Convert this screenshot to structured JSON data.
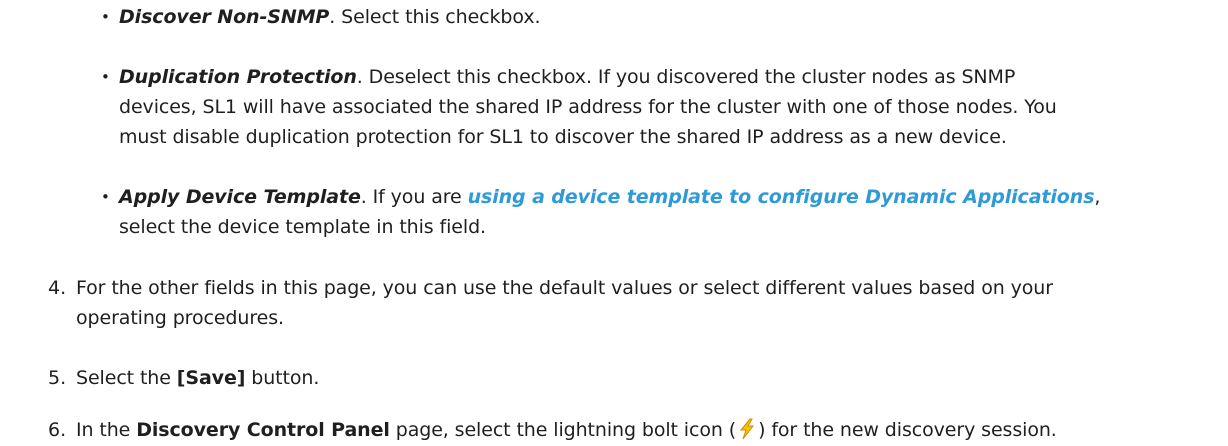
{
  "bullets": [
    {
      "term": "Discover Non-SNMP",
      "lines": [
        ". Select this checkbox."
      ]
    },
    {
      "term": "Duplication Protection",
      "lines": [
        ". Deselect this checkbox. If you discovered the cluster nodes as SNMP",
        "devices, SL1 will have associated the shared IP address for the cluster with one of those nodes. You",
        "must disable duplication protection for SL1 to discover the shared IP address as a new device."
      ]
    },
    {
      "term": "Apply Device Template",
      "pre_link": ". If you are ",
      "link": "using a device template to configure Dynamic Applications",
      "post_link": ",",
      "lines": [
        "select the device template in this field."
      ]
    }
  ],
  "steps": [
    {
      "number": "4.",
      "lines": [
        "For the other fields in this page, you can use the default values or select different values based on your",
        "operating procedures."
      ]
    },
    {
      "number": "5.",
      "pre": "Select the ",
      "bold": "[Save]",
      "post": " button."
    },
    {
      "number": "6.",
      "pre": "In the ",
      "bold": "Discovery Control Panel",
      "mid": " page, select the lightning bolt icon (",
      "icon": "lightning-bolt-icon",
      "post": ") for the new discovery session."
    }
  ],
  "colors": {
    "text": "#1f1f1f",
    "link": "#2f9ad8",
    "bolt_fill": "#f5c400",
    "bolt_stroke": "#d98a00"
  }
}
